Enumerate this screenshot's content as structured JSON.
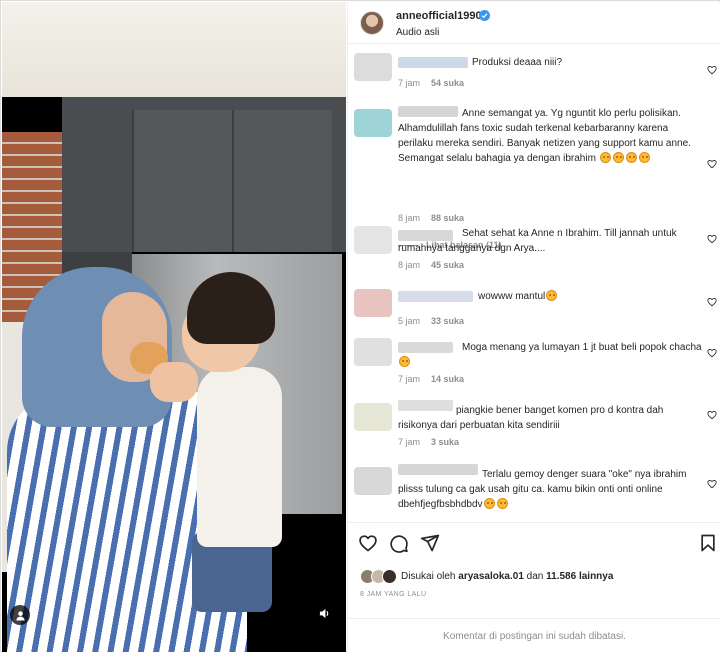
{
  "post": {
    "username": "anneofficial1990",
    "verified": true,
    "audio_label": "Audio asli"
  },
  "comments": [
    {
      "text": "Produksi deaaa niii?",
      "time": "7 jam",
      "likes": "54 suka",
      "emojis": 0,
      "avatar_color": "#dcdcdc",
      "name_color": "#cdd9e6"
    },
    {
      "text": "Anne semangat ya. Yg nguntit klo perlu polisikan. Alhamdulillah fans toxic sudah terkenal kebarbaranny karena perilaku mereka sendiri. Banyak netizen yang support kamu anne. Semangat selalu bahagia ya dengan ibrahim",
      "time": "8 jam",
      "likes": "88 suka",
      "emojis": 4,
      "avatar_color": "#9ed3d8",
      "name_color": "#d6d6d6",
      "replies": "Lihat balasan (11)"
    },
    {
      "text": "Sehat sehat ka Anne n Ibrahim. Till jannah untuk rumahnya tangganya dgn Arya....",
      "time": "8 jam",
      "likes": "45 suka",
      "emojis": 0,
      "avatar_color": "#e4e4e4",
      "name_color": "#d8d8d8"
    },
    {
      "text": "wowww mantul",
      "time": "5 jam",
      "likes": "33 suka",
      "emojis": 1,
      "avatar_color": "#e8c4c0",
      "name_color": "#d6dde8"
    },
    {
      "text": "Moga menang ya lumayan 1 jt buat beli popok chacha",
      "time": "7 jam",
      "likes": "14 suka",
      "emojis": 1,
      "avatar_color": "#e0e0e0",
      "name_color": "#dadada"
    },
    {
      "text": "piangkie bener banget komen pro d kontra dah risikonya dari perbuatan kita sendiriii",
      "time": "7 jam",
      "likes": "3 suka",
      "emojis": 0,
      "avatar_color": "#e6e6d6",
      "name_color": "#dedede"
    },
    {
      "text": "Terlalu gemoy denger suara \"oke\" nya ibrahim plisss tulung ca gak usah gitu ca. kamu bikin onti onti online dbehfjegfbsbhdbdv",
      "time": "",
      "likes": "",
      "emojis": 2,
      "avatar_color": "#d8d8d8",
      "name_color": "#d6d6d6"
    }
  ],
  "actions": {
    "like_icon": "heart-icon",
    "comment_icon": "comment-icon",
    "share_icon": "send-icon",
    "save_icon": "bookmark-icon"
  },
  "likes": {
    "prefix": "Disukai oleh",
    "user": "aryasaloka.01",
    "mid": "dan",
    "count": "11.586 lainnya"
  },
  "timeago": "8 JAM YANG LALU",
  "footer_text": "Komentar di postingan ini sudah dibatasi."
}
